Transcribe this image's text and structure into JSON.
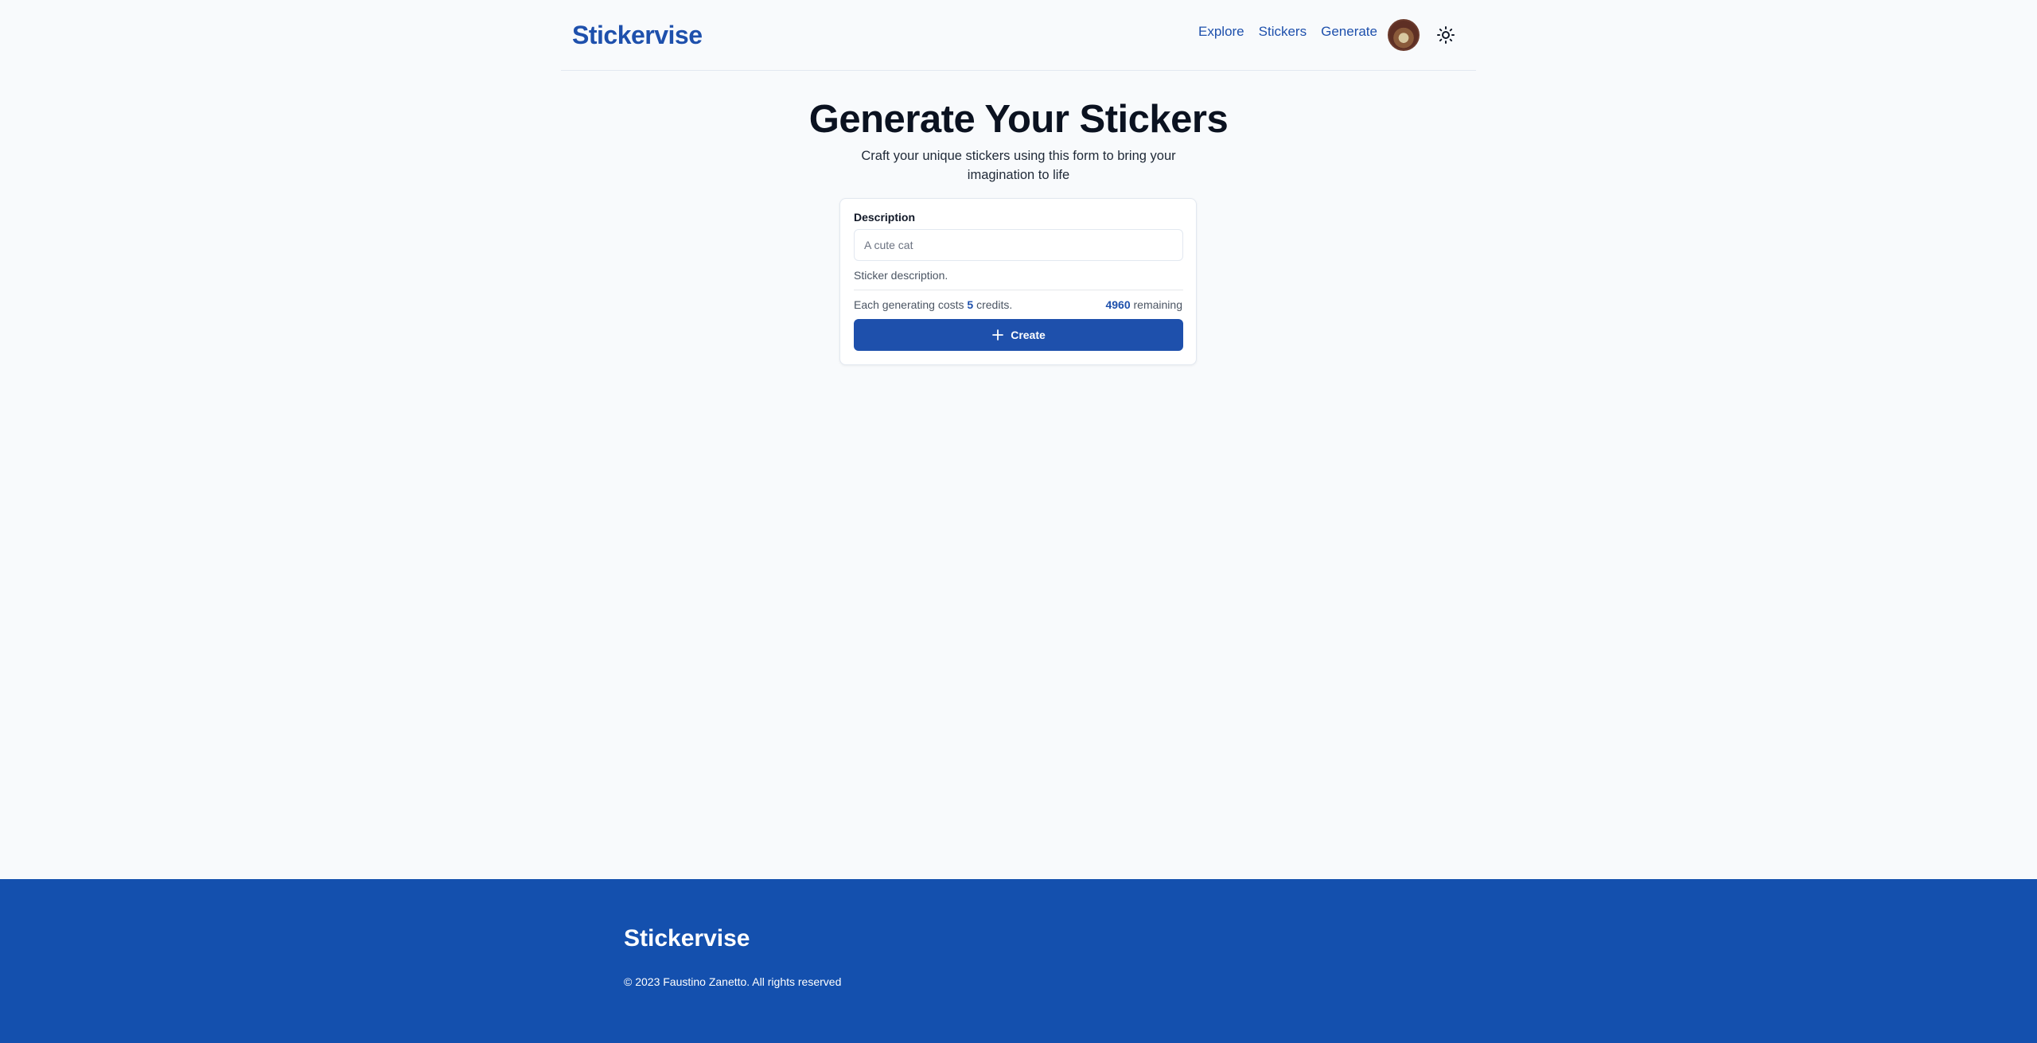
{
  "header": {
    "logo": "Stickervise",
    "nav": [
      "Explore",
      "Stickers",
      "Generate"
    ]
  },
  "main": {
    "title": "Generate Your Stickers",
    "subtitle": "Craft your unique stickers using this form to bring your imagination to life"
  },
  "form": {
    "description_label": "Description",
    "description_placeholder": "A cute cat",
    "description_value": "",
    "helper": "Sticker description.",
    "cost_prefix": "Each generating costs",
    "cost_value": "5",
    "cost_suffix": "credits.",
    "remaining_value": "4960",
    "remaining_suffix": "remaining",
    "create_label": "Create"
  },
  "footer": {
    "logo": "Stickervise",
    "copyright": "© 2023 Faustino Zanetto. All rights reserved"
  },
  "colors": {
    "brand": "#1e50ac",
    "footer_bg": "#1450ae",
    "background": "#f8fafc"
  },
  "icons": {
    "theme": "sun-icon",
    "create": "plus-icon"
  }
}
